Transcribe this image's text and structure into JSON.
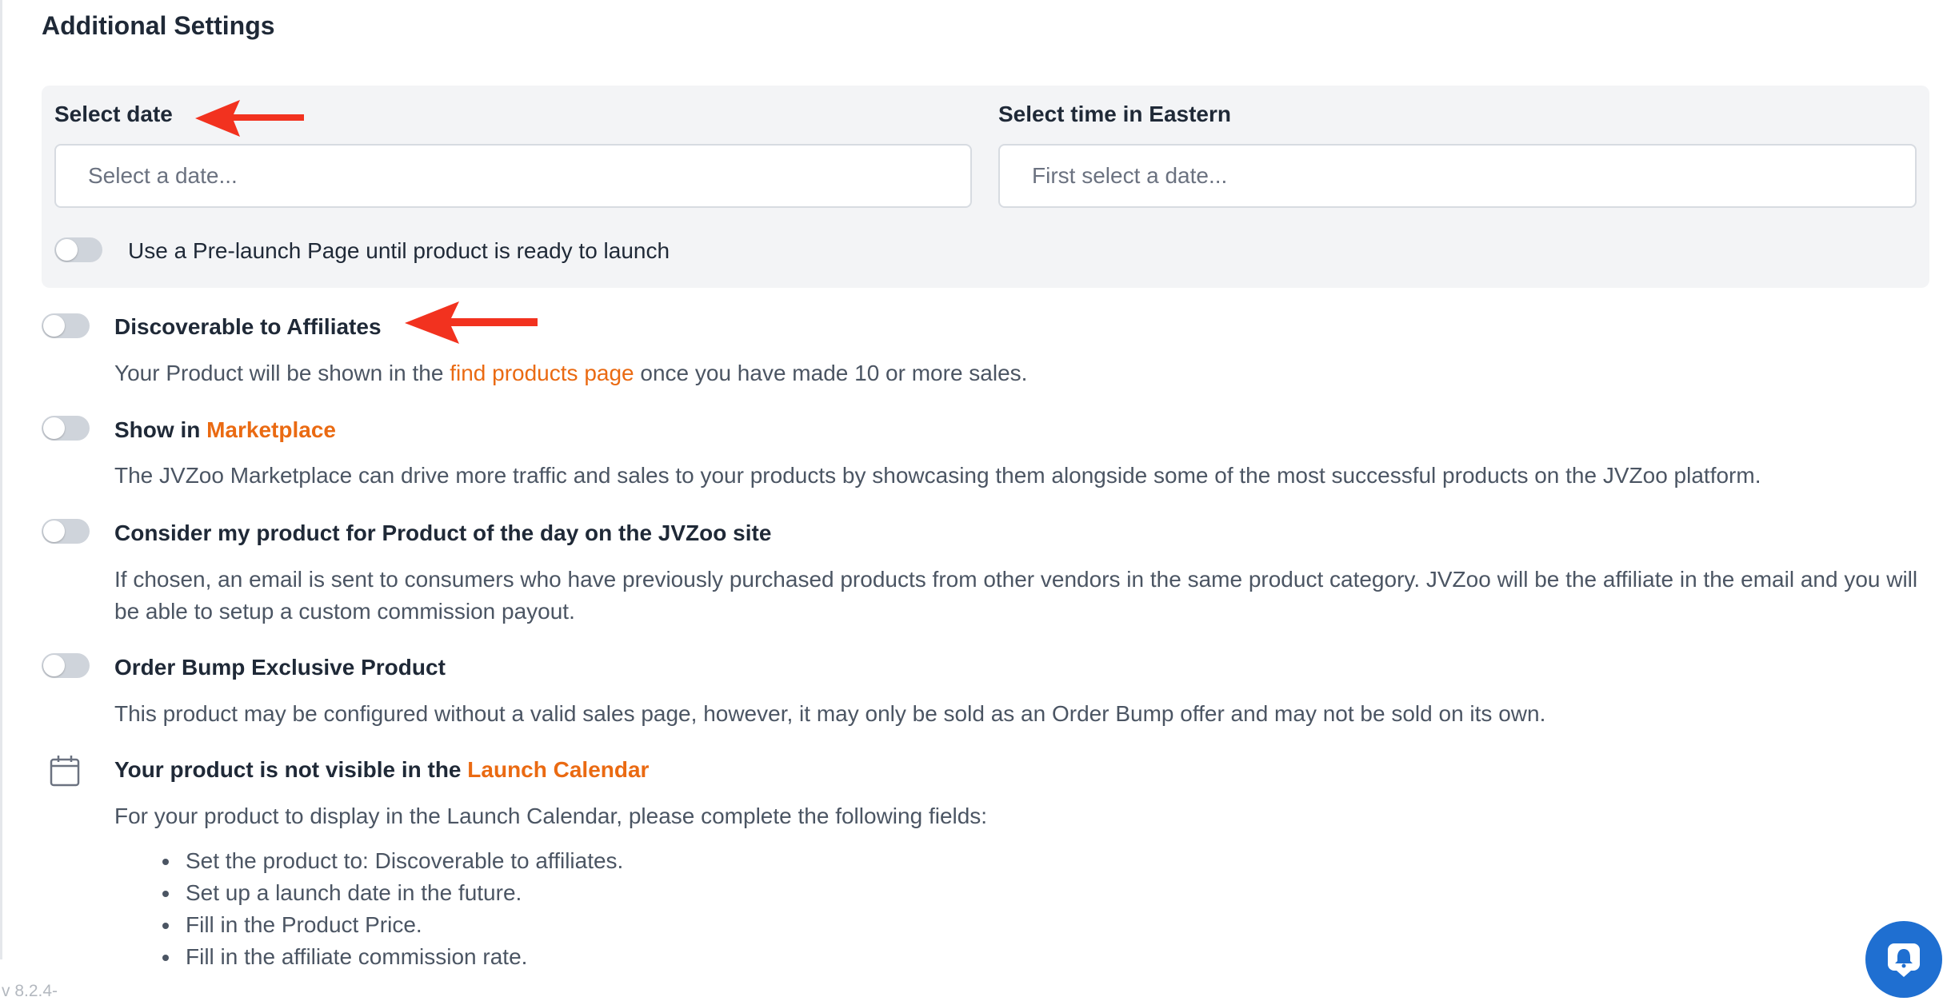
{
  "section_title": "Additional Settings",
  "date": {
    "label": "Select date",
    "placeholder": "Select a date..."
  },
  "time": {
    "label": "Select time in Eastern",
    "placeholder": "First select a date..."
  },
  "prelaunch": {
    "label": "Use a Pre-launch Page until product is ready to launch",
    "enabled": false
  },
  "discoverable": {
    "title": "Discoverable to Affiliates",
    "enabled": false,
    "desc_before": "Your Product will be shown in the ",
    "desc_link": "find products page",
    "desc_after": " once you have made 10 or more sales."
  },
  "marketplace": {
    "title_prefix": "Show in ",
    "title_link": "Marketplace",
    "enabled": false,
    "desc": "The JVZoo Marketplace can drive more traffic and sales to your products by showcasing them alongside some of the most successful products on the JVZoo platform."
  },
  "product_of_day": {
    "title": "Consider my product for Product of the day on the JVZoo site",
    "enabled": false,
    "desc": "If chosen, an email is sent to consumers who have previously purchased products from other vendors in the same product category. JVZoo will be the affiliate in the email and you will be able to setup a custom commission payout."
  },
  "order_bump": {
    "title": "Order Bump Exclusive Product",
    "enabled": false,
    "desc": "This product may be configured without a valid sales page, however, it may only be sold as an Order Bump offer and may not be sold on its own."
  },
  "launch_calendar": {
    "icon": "calendar-icon",
    "title_prefix": "Your product is not visible in the ",
    "title_link": "Launch Calendar",
    "desc": "For your product to display in the Launch Calendar, please complete the following fields:",
    "requirements": [
      "Set the product to: Discoverable to affiliates.",
      "Set up a launch date in the future.",
      "Fill in the Product Price.",
      "Fill in the affiliate commission rate."
    ]
  },
  "version": "v 8.2.4-",
  "colors": {
    "accent_link": "#ea6a12",
    "annotation_arrow": "#f2321f",
    "chat_button": "#1f6fd1"
  }
}
